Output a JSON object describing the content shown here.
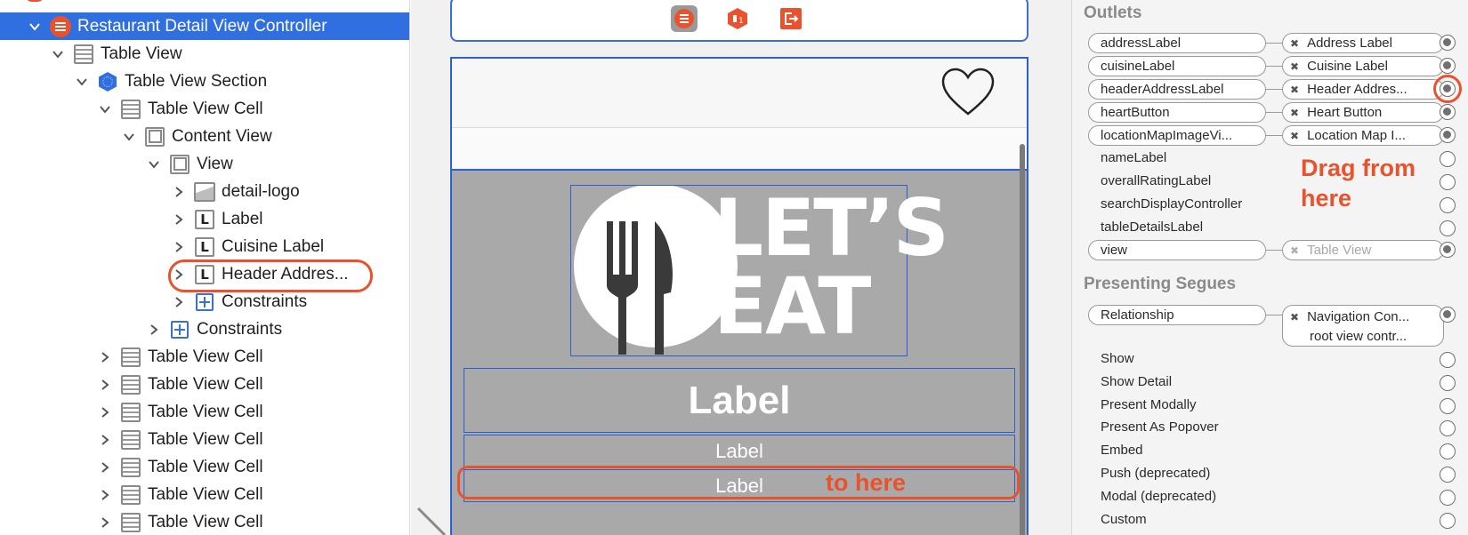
{
  "outline": {
    "items": [
      {
        "label": "Restaurant Detail View Controller",
        "icon": "view-controller-icon"
      },
      {
        "label": "Table View",
        "icon": "table-view-icon"
      },
      {
        "label": "Table View Section",
        "icon": "table-view-section-icon"
      },
      {
        "label": "Table View Cell",
        "icon": "table-view-cell-icon"
      },
      {
        "label": "Content View",
        "icon": "view-icon"
      },
      {
        "label": "View",
        "icon": "view-icon"
      },
      {
        "label": "detail-logo",
        "icon": "image-view-icon"
      },
      {
        "label": "Label",
        "icon": "label-icon"
      },
      {
        "label": "Cuisine Label",
        "icon": "label-icon"
      },
      {
        "label": "Header Addres...",
        "icon": "label-icon"
      },
      {
        "label": "Constraints",
        "icon": "constraints-icon"
      },
      {
        "label": "Constraints",
        "icon": "constraints-icon"
      },
      {
        "label": "Table View Cell",
        "icon": "table-view-cell-icon"
      },
      {
        "label": "Table View Cell",
        "icon": "table-view-cell-icon"
      },
      {
        "label": "Table View Cell",
        "icon": "table-view-cell-icon"
      },
      {
        "label": "Table View Cell",
        "icon": "table-view-cell-icon"
      },
      {
        "label": "Table View Cell",
        "icon": "table-view-cell-icon"
      },
      {
        "label": "Table View Cell",
        "icon": "table-view-cell-icon"
      },
      {
        "label": "Table View Cell",
        "icon": "table-view-cell-icon"
      }
    ],
    "icon_glyph_label": "L"
  },
  "canvas": {
    "logo_line1": "LET’S",
    "logo_line2": "EAT",
    "name_label": "Label",
    "cuisine_label": "Label",
    "address_label": "Label",
    "scene_icons": [
      "view-controller-icon",
      "first-responder-icon",
      "exit-icon"
    ],
    "annotation_to": "to here"
  },
  "inspector": {
    "outlets_title": "Outlets",
    "outlets": [
      {
        "name": "addressLabel",
        "target": "Address Label",
        "connected": true
      },
      {
        "name": "cuisineLabel",
        "target": "Cuisine Label",
        "connected": true
      },
      {
        "name": "headerAddressLabel",
        "target": "Header Addres...",
        "connected": true
      },
      {
        "name": "heartButton",
        "target": "Heart Button",
        "connected": true
      },
      {
        "name": "locationMapImageVi...",
        "target": "Location Map I...",
        "connected": true
      },
      {
        "name": "nameLabel",
        "target": "",
        "connected": false
      },
      {
        "name": "overallRatingLabel",
        "target": "",
        "connected": false
      },
      {
        "name": "searchDisplayController",
        "target": "",
        "connected": false
      },
      {
        "name": "tableDetailsLabel",
        "target": "",
        "connected": false
      },
      {
        "name": "view",
        "target": "Table View",
        "connected": true
      }
    ],
    "annotation_from": "Drag from here",
    "segues_title": "Presenting Segues",
    "relationship": {
      "name": "Relationship",
      "target_line1": "Navigation Con...",
      "target_line2": "root view contr..."
    },
    "segues": [
      "Show",
      "Show Detail",
      "Present Modally",
      "Present As Popover",
      "Embed",
      "Push (deprecated)",
      "Modal (deprecated)",
      "Custom"
    ]
  },
  "colors": {
    "selection": "#2f6fe0",
    "accent_orange": "#e8532d",
    "storyboard_blue": "#2b5fd4",
    "cell_gray": "#a9a9a9"
  }
}
